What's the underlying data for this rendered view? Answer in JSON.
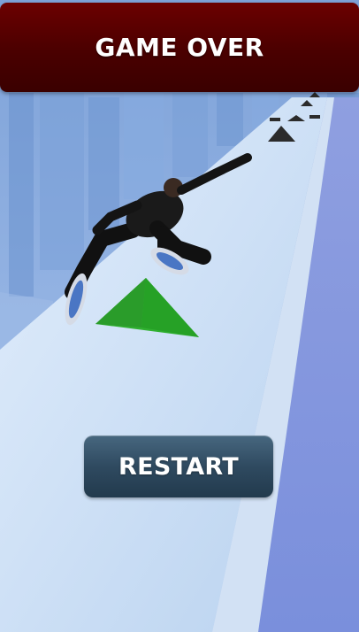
{
  "banner": {
    "title": "GAME OVER"
  },
  "buttons": {
    "restart_label": "RESTART"
  },
  "colors": {
    "banner": "#4a0000",
    "button": "#2f4a60",
    "track": "#c7dcf2",
    "sky": "#8fb4e6",
    "obstacle": "#2ea82e"
  },
  "scene": {
    "character": "inline-skater",
    "obstacle": "green-pyramid",
    "track_obstacles": "black-spikes"
  }
}
